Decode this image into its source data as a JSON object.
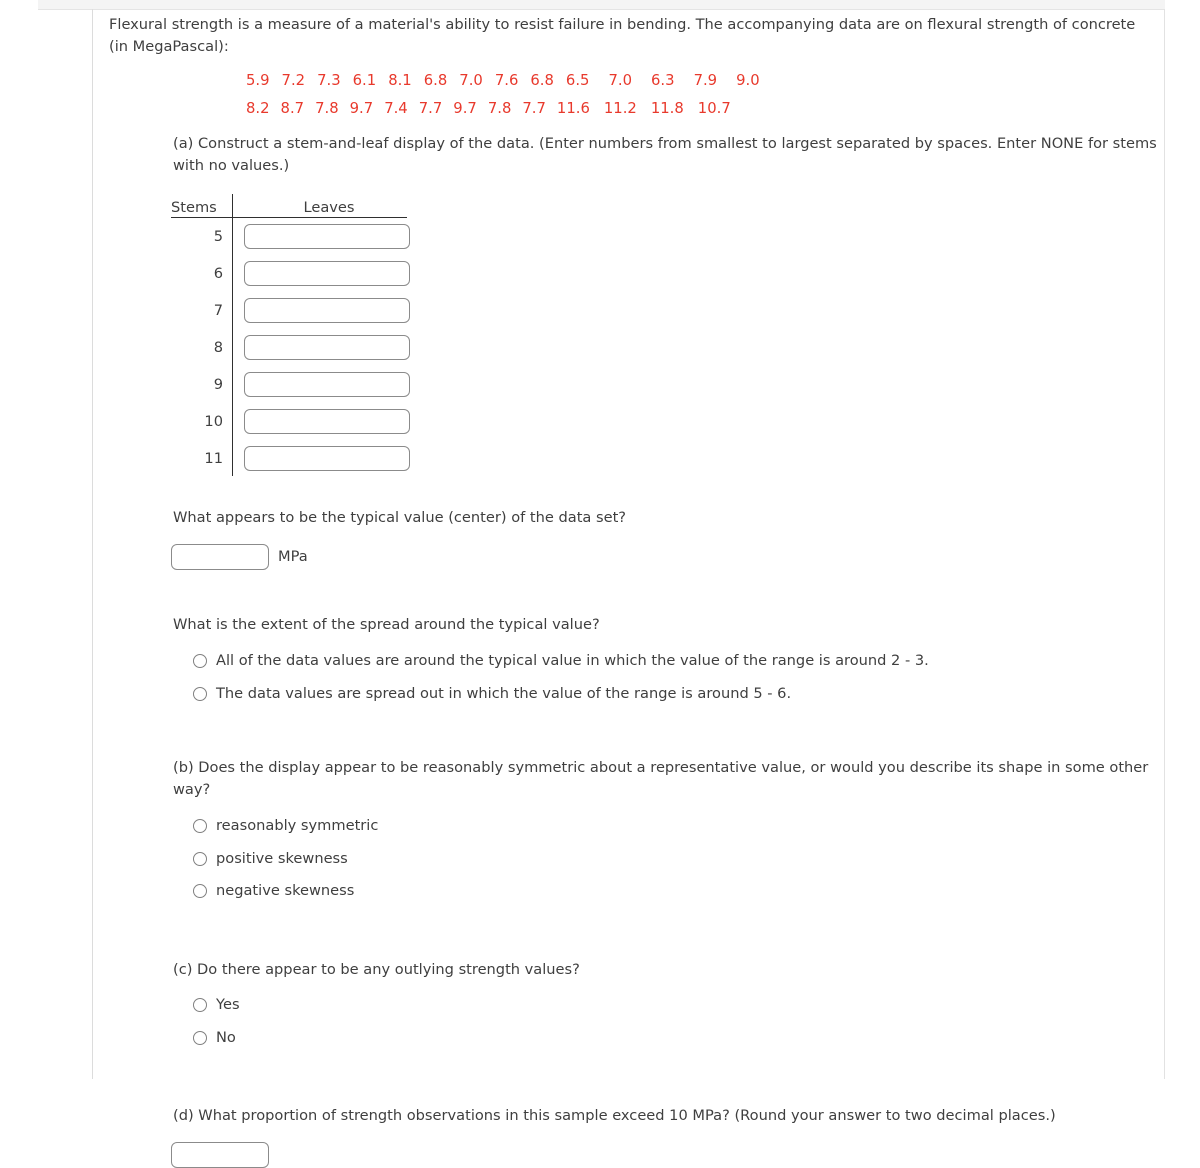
{
  "problem": {
    "intro": "Flexural strength is a measure of a material's ability to resist failure in bending. The accompanying data are on flexural strength of concrete (in MegaPascal):",
    "data_color": "#e8392c",
    "data_rows": [
      [
        "5.9",
        "7.2",
        "7.3",
        "6.1",
        "8.1",
        "6.8",
        "7.0",
        "7.6",
        "6.8",
        "6.5",
        "7.0",
        "6.3",
        "7.9",
        "9.0"
      ],
      [
        "8.2",
        "8.7",
        "7.8",
        "9.7",
        "7.4",
        "7.7",
        "9.7",
        "7.8",
        "7.7",
        "11.6",
        "11.2",
        "11.8",
        "10.7"
      ]
    ]
  },
  "part_a": {
    "prompt": "(a) Construct a stem-and-leaf display of the data. (Enter numbers from smallest to largest separated by spaces. Enter NONE for stems with no values.)",
    "table": {
      "stems_header": "Stems",
      "leaves_header": "Leaves",
      "rows": [
        {
          "stem": "5",
          "leaves": "",
          "placeholder": ""
        },
        {
          "stem": "6",
          "leaves": "",
          "placeholder": ""
        },
        {
          "stem": "7",
          "leaves": "",
          "placeholder": ""
        },
        {
          "stem": "8",
          "leaves": "",
          "placeholder": ""
        },
        {
          "stem": "9",
          "leaves": "",
          "placeholder": ""
        },
        {
          "stem": "10",
          "leaves": "",
          "placeholder": ""
        },
        {
          "stem": "11",
          "leaves": "",
          "placeholder": ""
        }
      ]
    },
    "center_question": "What appears to be the typical value (center) of the data set?",
    "center_value": "",
    "center_placeholder": "",
    "center_unit": "MPa",
    "spread_question": "What is the extent of the spread around the typical value?",
    "spread_options": [
      "All of the data values are around the typical value in which the value of the range is around 2 - 3.",
      "The data values are spread out in which the value of the range is around 5 - 6."
    ]
  },
  "part_b": {
    "prompt": "(b) Does the display appear to be reasonably symmetric about a representative value, or would you describe its shape in some other way?",
    "options": [
      "reasonably symmetric",
      "positive skewness",
      "negative skewness"
    ]
  },
  "part_c": {
    "prompt": "(c) Do there appear to be any outlying strength values?",
    "options": [
      "Yes",
      "No"
    ]
  },
  "part_d": {
    "prompt": "(d) What proportion of strength observations in this sample exceed 10 MPa? (Round your answer to two decimal places.)",
    "value": "",
    "placeholder": ""
  }
}
